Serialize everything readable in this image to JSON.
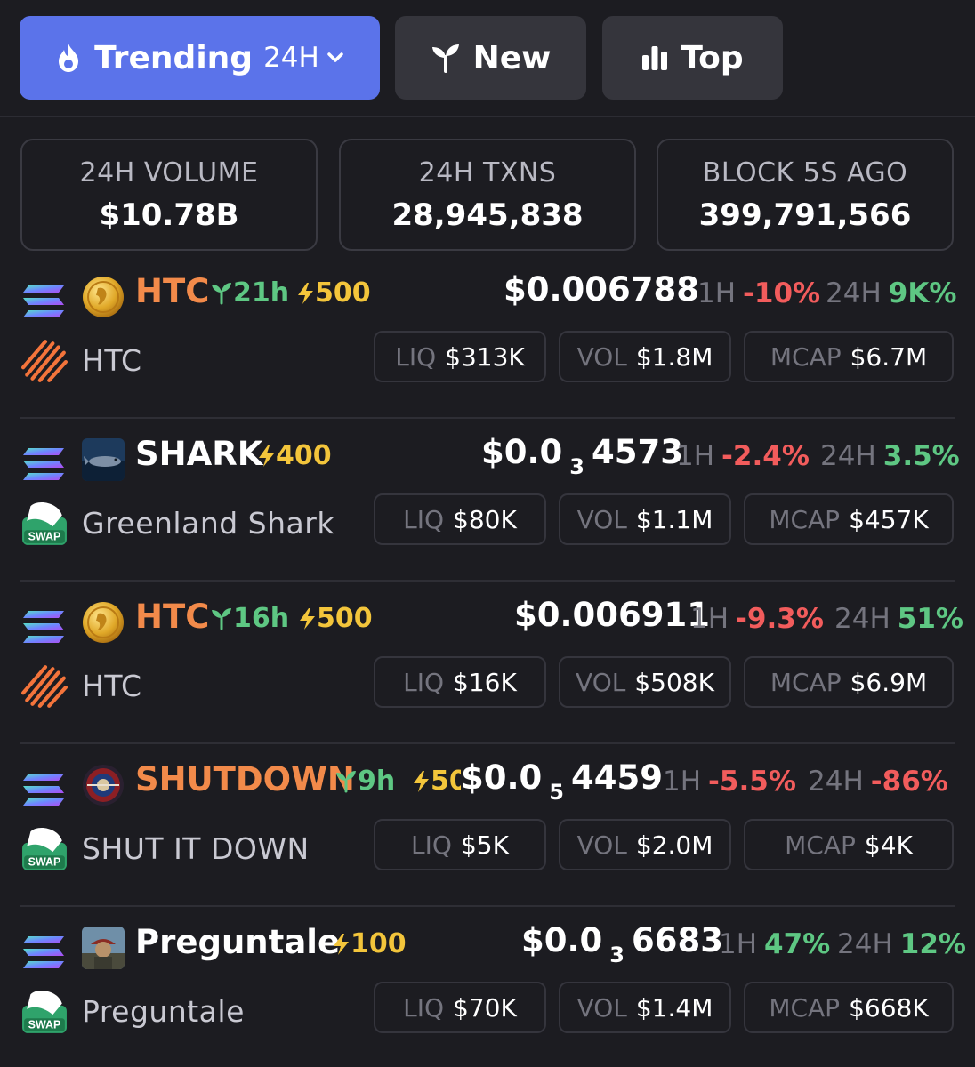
{
  "tabs": {
    "trending": {
      "label": "Trending",
      "timeframe": "24H"
    },
    "new": {
      "label": "New"
    },
    "top": {
      "label": "Top"
    }
  },
  "stats": [
    {
      "label": "24H VOLUME",
      "value": "$10.78B"
    },
    {
      "label": "24H TXNS",
      "value": "28,945,838"
    },
    {
      "label": "BLOCK 5S AGO",
      "value": "399,791,566"
    }
  ],
  "labels": {
    "h1": "1H",
    "h24": "24H",
    "liq": "LIQ",
    "vol": "VOL",
    "mcap": "MCAP"
  },
  "tokens": [
    {
      "symbol": "HTC",
      "age": "21h",
      "boost": "500",
      "price_main": "$0.006788",
      "price_sub": "",
      "price_tail": "",
      "change_1h": "-10%",
      "change_24h": "9K%",
      "name": "HTC",
      "liq": "$313K",
      "vol": "$1.8M",
      "mcap": "$6.7M",
      "dex": "raydium-icon"
    },
    {
      "symbol": "SHARK",
      "age": "",
      "boost": "400",
      "price_main": "$0.0",
      "price_sub": "3",
      "price_tail": "4573",
      "change_1h": "-2.4%",
      "change_24h": "3.5%",
      "name": "Greenland Shark",
      "liq": "$80K",
      "vol": "$1.1M",
      "mcap": "$457K",
      "dex": "swap-icon"
    },
    {
      "symbol": "HTC",
      "age": "16h",
      "boost": "500",
      "price_main": "$0.006911",
      "price_sub": "",
      "price_tail": "",
      "change_1h": "-9.3%",
      "change_24h": "51%",
      "name": "HTC",
      "liq": "$16K",
      "vol": "$508K",
      "mcap": "$6.9M",
      "dex": "raydium-icon"
    },
    {
      "symbol": "SHUTDOWN",
      "age": "9h",
      "boost": "50",
      "price_main": "$0.0",
      "price_sub": "5",
      "price_tail": "4459",
      "change_1h": "-5.5%",
      "change_24h": "-86%",
      "name": "SHUT IT DOWN",
      "liq": "$5K",
      "vol": "$2.0M",
      "mcap": "$4K",
      "dex": "swap-icon"
    },
    {
      "symbol": "Preguntale",
      "age": "",
      "boost": "100",
      "price_main": "$0.0",
      "price_sub": "3",
      "price_tail": "6683",
      "change_1h": "47%",
      "change_24h": "12%",
      "name": "Preguntale",
      "liq": "$70K",
      "vol": "$1.4M",
      "mcap": "$668K",
      "dex": "swap-icon"
    }
  ],
  "colors": {
    "accent": "#5b73ea",
    "positive": "#5ec783",
    "negative": "#f25c5c",
    "boost": "#f3c53b",
    "symbol_orange": "#f28a4a"
  }
}
